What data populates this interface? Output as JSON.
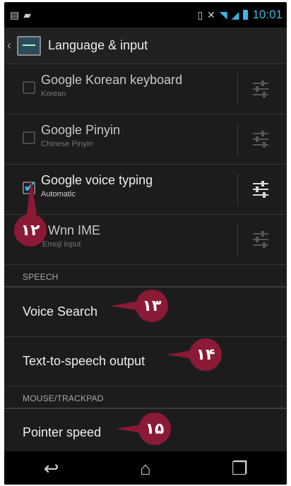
{
  "status_bar": {
    "time": "10:01",
    "left_icons": [
      "message-icon",
      "android-icon"
    ],
    "right_icons": [
      "sim-icon",
      "mute-icon",
      "wifi-icon",
      "signal-icon",
      "battery-icon"
    ]
  },
  "action_bar": {
    "title": "Language & input",
    "icon": "settings-app-icon"
  },
  "keyboards": [
    {
      "title": "Google Korean keyboard",
      "subtitle": "Korean",
      "checked": false
    },
    {
      "title": "Google Pinyin",
      "subtitle": "Chinese Pinyin",
      "checked": false
    },
    {
      "title": "Google voice typing",
      "subtitle": "Automatic",
      "checked": true
    },
    {
      "title": "Wnn IME",
      "subtitle": "Emoji input",
      "checked": false
    }
  ],
  "sections": {
    "speech": "SPEECH",
    "mouse": "MOUSE/TRACKPAD"
  },
  "prefs": {
    "voice_search": "Voice Search",
    "tts_output": "Text-to-speech output",
    "pointer_speed": "Pointer speed"
  },
  "annotations": [
    "۱۲",
    "۱۳",
    "۱۴",
    "۱۵"
  ],
  "colors": {
    "accent": "#39b8e6",
    "annotation": "#8a1a36",
    "background": "#1c1c1c"
  }
}
